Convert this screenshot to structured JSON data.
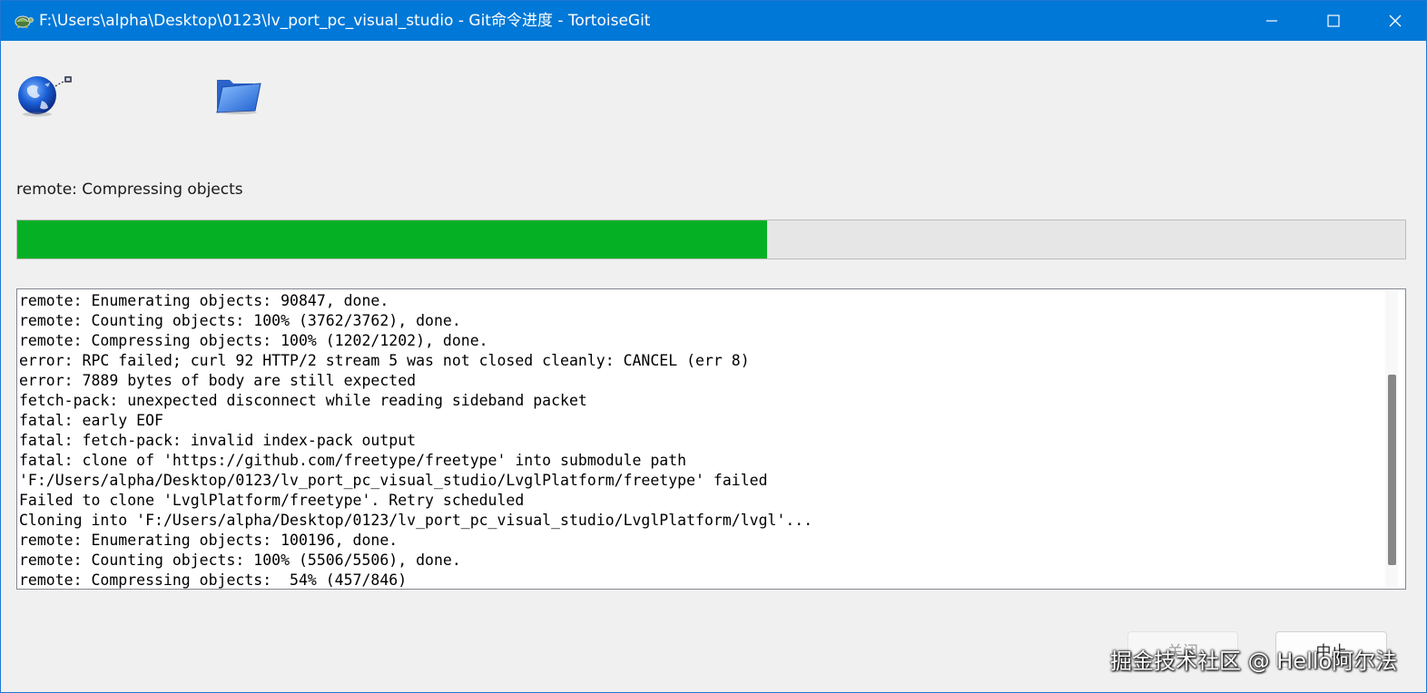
{
  "window": {
    "title": "F:\\Users\\alpha\\Desktop\\0123\\lv_port_pc_visual_studio - Git命令进度 - TortoiseGit",
    "controls": {
      "minimize": "—",
      "maximize": "☐",
      "close": "✕"
    }
  },
  "icons": {
    "app": "tortoise-icon",
    "remote": "globe-network-icon",
    "local": "folder-icon"
  },
  "status": {
    "text": "remote: Compressing objects"
  },
  "progress": {
    "percent": 54,
    "fill_color": "#06b025"
  },
  "log": {
    "lines": [
      "remote: Enumerating objects: 90847, done.",
      "remote: Counting objects: 100% (3762/3762), done.",
      "remote: Compressing objects: 100% (1202/1202), done.",
      "error: RPC failed; curl 92 HTTP/2 stream 5 was not closed cleanly: CANCEL (err 8)",
      "error: 7889 bytes of body are still expected",
      "fetch-pack: unexpected disconnect while reading sideband packet",
      "fatal: early EOF",
      "fatal: fetch-pack: invalid index-pack output",
      "fatal: clone of 'https://github.com/freetype/freetype' into submodule path",
      "'F:/Users/alpha/Desktop/0123/lv_port_pc_visual_studio/LvglPlatform/freetype' failed",
      "Failed to clone 'LvglPlatform/freetype'. Retry scheduled",
      "Cloning into 'F:/Users/alpha/Desktop/0123/lv_port_pc_visual_studio/LvglPlatform/lvgl'...",
      "remote: Enumerating objects: 100196, done.",
      "remote: Counting objects: 100% (5506/5506), done.",
      "remote: Compressing objects:  54% (457/846)"
    ]
  },
  "buttons": {
    "close": "关闭",
    "abort": "中止"
  },
  "watermark": "掘金技术社区 @ Hello阿尔法"
}
